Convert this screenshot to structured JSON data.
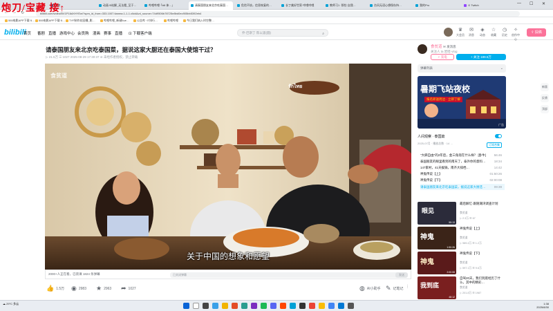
{
  "overlay_text": "炮刀/宝藏  接↑",
  "browser": {
    "tabs": [
      "购物",
      "动画·B站解_无法看_至于…",
      "哔哩哔哩·「bili 体…」",
      "请泰国朋友来北京吃泰国…",
      "危险不妨，信息恢复的…",
      "长丁美好世家·哔哩哔哩",
      "教师习1 ·那些 自我…",
      "台风无语心想保存持…",
      "我的Pro",
      "⊙ Twitch"
    ],
    "url": "bilibili.com/video/BV1P16dXHYEw/?spm_id_from=333.1007.tianma.1-1-1.click&vd_source=74d9506b78725e8bd0ec905bb5392eb4",
    "bookmarks": [
      "555电影APP下载·5…",
      "555电影APP下载·5…",
      "TYF制作花园播_影…",
      "哔哩哔哩_新键5ue…",
      "公告哔 ·IT排行…",
      "哔哩哔哩",
      "今日我们纳入时空整…"
    ]
  },
  "header": {
    "logo": "bilibili",
    "nav": [
      "首页",
      "番剧",
      "直播",
      "游戏中心",
      "会员购",
      "漫画",
      "赛事",
      "直播",
      "下载客户端"
    ],
    "search_placeholder": "乔·巴斯丁·陈以遥(圆)",
    "icons": [
      {
        "name": "大会员",
        "label": "大会员"
      },
      {
        "name": "消息",
        "label": "消息"
      },
      {
        "name": "动态",
        "label": "动态"
      },
      {
        "name": "收藏",
        "label": "收藏"
      },
      {
        "name": "历史",
        "label": "历史"
      },
      {
        "name": "创作中心",
        "label": "创作中心"
      }
    ],
    "upload": "投稿"
  },
  "video": {
    "title": "请泰国朋友来北京吃泰国菜，据说这家大厨还在泰国大使馆干过？",
    "meta": "▷ 21.5万    ☰ 1027    2025-08-29 17:30:37    ⊘ 未经作者授权，禁止转载",
    "watermark": "食贫道",
    "subtitle": "关于中国的想象和愿望",
    "sign": "รักไทย",
    "danmu_count": "2000+人正在看，已装填 1824 条弹幕",
    "danmu_placeholder": "已关闭弹幕",
    "danmu_send": "发送"
  },
  "toolbar": {
    "like": "1.5万",
    "coin": "2983",
    "fav": "2963",
    "share": "1027",
    "ai": "AI小助手",
    "notes": "记笔记",
    "more": "⋮"
  },
  "sidebar": {
    "up_name": "食贫道",
    "up_badge": "发消息",
    "up_desc": "关注人 ta   岩哈·vlog",
    "charge": "⚡ 充电",
    "follow": "+ 关注 189.5万",
    "danmu_list": "弹幕列表",
    "ad": {
      "title": "暑期飞站夜校",
      "sub": "报名即送周边 · 立即了解",
      "tag": "广告"
    },
    "playlist": {
      "head": "人间观察 · 泰国篇",
      "sub": "2025-07月 · 播放总数 · 14 …",
      "subscribe": "订阅合集",
      "items": [
        {
          "title": "\"大麻自由\"的2年后，金三角现在什么样？ [卧牛]",
          "dur": "56:46"
        },
        {
          "title": "泰国朋友的眼里看到的南天了，泰外你的意料吗？",
          "dur": "18:34"
        },
        {
          "title": "147家村，41天挨锅，南齐大排档…",
          "dur": "14:42"
        },
        {
          "title": "神鬼传说【上】",
          "dur": "01:50:26"
        },
        {
          "title": "神鬼传说【下】",
          "dur": "02:00:08"
        },
        {
          "title": "请泰国朋友来北京吃泰国菜，据说这家大厨还在…",
          "dur": "09:39"
        }
      ],
      "more": "请泰国朋友来北京吃泰国菜，据说这家大厨还…"
    },
    "recommend": [
      {
        "title": "最后解忆·跟随潮湾调查计划",
        "author": "食贫道",
        "stats": "▷ 2.3万 ☰ 67",
        "dur": "55:13"
      },
      {
        "title": "神鬼传说【上】",
        "author": "食贫道",
        "stats": "▷ 989.4万 ☰ 1.2万",
        "dur": "1:50:26"
      },
      {
        "title": "神鬼传说【下】",
        "author": "食贫道",
        "stats": "▷ 597.1万 ☰ 9.6万",
        "dur": "2:00:08"
      },
      {
        "title": "自驾20天，我们到底经历了什么，其中的精彩…",
        "author": "食贫道",
        "stats": "▷ 201.8万 ☰ 1987",
        "dur": "48:12"
      }
    ],
    "float_buttons": [
      "新版",
      "反馈",
      "顶部"
    ]
  },
  "taskbar": {
    "weather": "29°C\n多云",
    "time": "1:38",
    "date": "2025/8/30"
  },
  "colors": {
    "accent": "#00aeec",
    "pink": "#fb7299"
  }
}
